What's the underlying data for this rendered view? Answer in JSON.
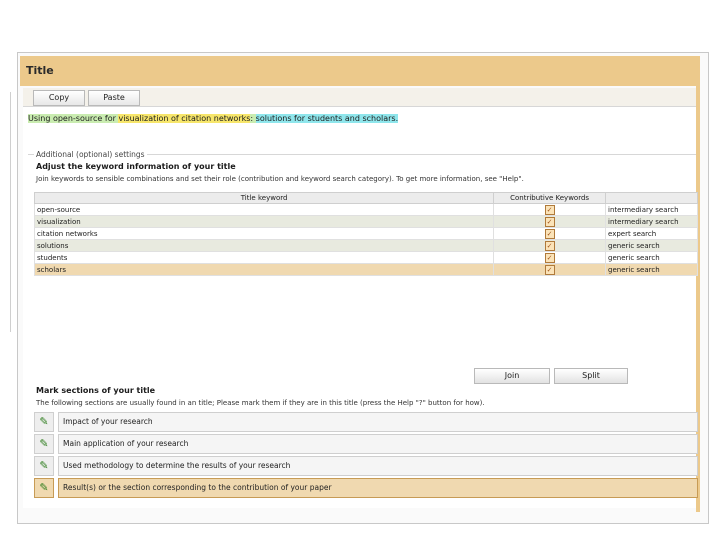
{
  "window": {
    "title": "Title"
  },
  "toolbar": {
    "copy_label": "Copy",
    "paste_label": "Paste"
  },
  "title_text": {
    "segments": [
      {
        "text": "Using open-source for ",
        "style": "green"
      },
      {
        "text": "visualization of citation networks",
        "style": "yellow"
      },
      {
        "text": ": ",
        "style": "green"
      },
      {
        "text": "solutions for students and scholars.",
        "style": "cyan"
      }
    ]
  },
  "settings": {
    "legend": "Additional (optional) settings",
    "heading": "Adjust the keyword information of your title",
    "description": "Join keywords to sensible combinations and set their role (contribution and keyword search category). To get more information, see \"Help\".",
    "table": {
      "headers": [
        "Title keyword",
        "Contributive Keywords",
        ""
      ],
      "rows": [
        {
          "keyword": "open-source",
          "contributive": true,
          "category": "intermediary search"
        },
        {
          "keyword": "visualization",
          "contributive": true,
          "category": "intermediary search"
        },
        {
          "keyword": "citation networks",
          "contributive": true,
          "category": "expert search"
        },
        {
          "keyword": "solutions",
          "contributive": true,
          "category": "generic search"
        },
        {
          "keyword": "students",
          "contributive": true,
          "category": "generic search"
        },
        {
          "keyword": "scholars",
          "contributive": true,
          "category": "generic search"
        }
      ]
    },
    "join_label": "Join",
    "split_label": "Split"
  },
  "sections": {
    "heading": "Mark sections of your title",
    "description": "The following sections are usually found in an title; Please mark them if they are in this title (press the Help \"?\" button for how).",
    "items": [
      "Impact of your research",
      "Main application of your research",
      "Used methodology to determine the results of your research",
      "Result(s) or the section corresponding to the contribution of your paper"
    ]
  },
  "colors": {
    "title_bar": "#ecc98b",
    "selected_row": "#f0d9b0",
    "highlight_green": "#c9ecb0",
    "highlight_yellow": "#f7e66b",
    "highlight_cyan": "#8fe6ec"
  },
  "icons": {
    "section_marker": "check-pencil-icon",
    "checkbox": "checkbox-icon"
  }
}
